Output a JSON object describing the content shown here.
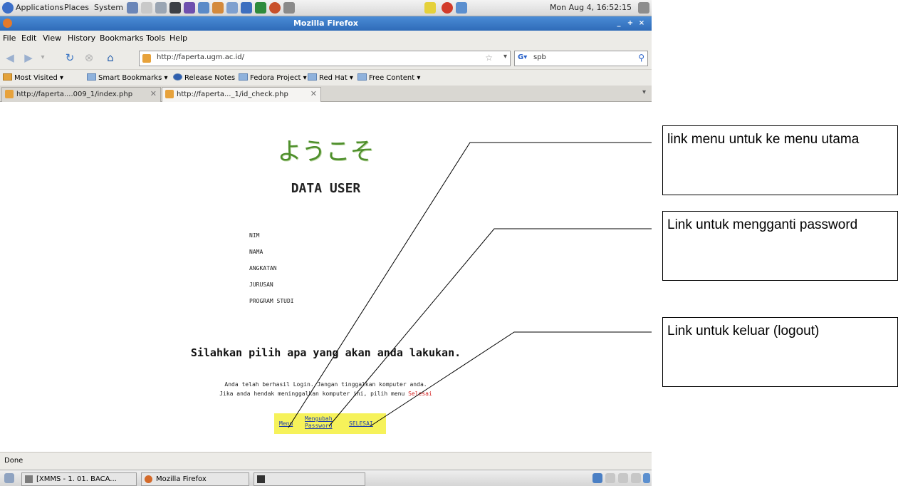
{
  "top_panel": {
    "menus": [
      "Applications",
      "Places",
      "System"
    ],
    "clock": "Mon Aug  4, 16:52:15"
  },
  "window": {
    "title": "Mozilla Firefox",
    "menu": [
      "File",
      "Edit",
      "View",
      "History",
      "Bookmarks",
      "Tools",
      "Help"
    ]
  },
  "navbar": {
    "url": "http://faperta.ugm.ac.id/",
    "search_value": "spb"
  },
  "bookmarks": [
    "Most Visited",
    "Smart Bookmarks",
    "Release Notes",
    "Fedora Project",
    "Red Hat",
    "Free Content"
  ],
  "tabs": [
    {
      "label": "http://faperta....009_1/index.php"
    },
    {
      "label": "http://faperta..._1/id_check.php"
    }
  ],
  "page": {
    "welcome": "ようこそ",
    "title": "DATA USER",
    "fields": [
      "NIM",
      "NAMA",
      "ANGKATAN",
      "JURUSAN",
      "PROGRAM STUDI"
    ],
    "prompt": "Silahkan pilih apa yang akan anda lakukan.",
    "info_line1": "Anda telah berhasil Login. Jangan tinggalkan komputer anda.",
    "info_line2_prefix": "Jika anda hendak meninggalkan komputer ini, pilih menu ",
    "info_line2_link": "Selesai",
    "links": {
      "menu": "Menu",
      "ubah_line1": "Mengubah",
      "ubah_line2": "Password",
      "selesai": "SELESAI"
    }
  },
  "status": "Done",
  "taskbar": {
    "tasks": [
      "[XMMS - 1. 01. BACA...",
      "Mozilla Firefox"
    ]
  },
  "annotations": {
    "menu_link": "link menu untuk ke menu utama",
    "password_link": "Link untuk mengganti password",
    "logout_link": "Link untuk keluar (logout)"
  }
}
